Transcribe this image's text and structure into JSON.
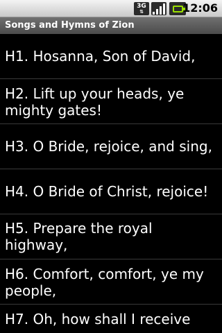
{
  "status_bar": {
    "network": "3G",
    "time": "12:06",
    "colors": {
      "battery": "#9be000"
    }
  },
  "app": {
    "title": "Songs and Hymns of Zion"
  },
  "hymns": [
    {
      "label": "H1. Hosanna, Son of David,"
    },
    {
      "label": "H2. Lift up your heads, ye mighty gates!"
    },
    {
      "label": "H3. O Bride, rejoice, and sing,"
    },
    {
      "label": "H4. O Bride of Christ, rejoice!"
    },
    {
      "label": "H5. Prepare the royal highway,"
    },
    {
      "label": "H6. Comfort, comfort, ye my people,"
    },
    {
      "label": "H7. Oh, how shall I receive"
    }
  ]
}
